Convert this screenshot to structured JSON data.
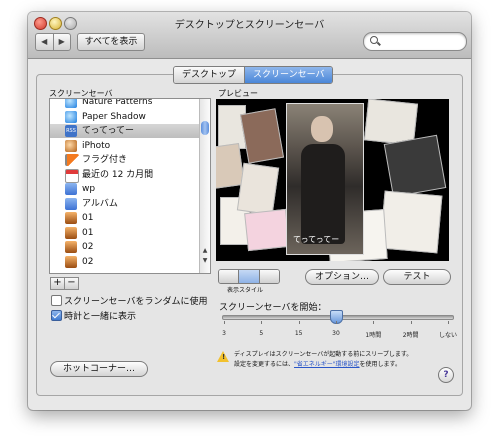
{
  "window": {
    "title": "デスクトップとスクリーンセーバ"
  },
  "toolbar": {
    "show_all": "すべてを表示",
    "back": "◀",
    "forward": "▶"
  },
  "tabs": [
    {
      "label": "デスクトップ"
    },
    {
      "label": "スクリーンセーバ"
    }
  ],
  "sidebar": {
    "heading": "スクリーンセーバ",
    "items": [
      {
        "label": "Nature Patterns"
      },
      {
        "label": "Paper Shadow"
      },
      {
        "label": "てってってー"
      },
      {
        "label": "iPhoto"
      },
      {
        "label": "フラグ付き"
      },
      {
        "label": "最近の 12 カ月間"
      },
      {
        "label": "wp"
      },
      {
        "label": "アルバム"
      },
      {
        "label": "01"
      },
      {
        "label": "01"
      },
      {
        "label": "02"
      },
      {
        "label": "02"
      }
    ],
    "selected_index": 2,
    "add": "+",
    "remove": "−"
  },
  "options": {
    "random_label": "スクリーンセーバをランダムに使用",
    "clock_label": "時計と一緒に表示",
    "random_checked": false,
    "clock_checked": true
  },
  "preview": {
    "heading": "プレビュー",
    "photo_caption": "てってってー",
    "display_style_label": "表示スタイル"
  },
  "buttons": {
    "options": "オプション…",
    "test": "テスト",
    "hot_corners": "ホットコーナー…"
  },
  "slider": {
    "label": "スクリーンセーバを開始：",
    "ticks": [
      "3",
      "5",
      "15",
      "30",
      "1時間",
      "2時間",
      "しない"
    ],
    "selected": "30"
  },
  "warning": {
    "line1": "ディスプレイはスクリーンセーバが起動する前にスリープします。",
    "line2_prefix": "設定を変更するには、",
    "line2_link": "\"省エネルギー\"環境設定",
    "line2_suffix": "を使用します。"
  },
  "help": "?",
  "icons": {
    "warning": "warning-icon",
    "search": "search-icon"
  }
}
